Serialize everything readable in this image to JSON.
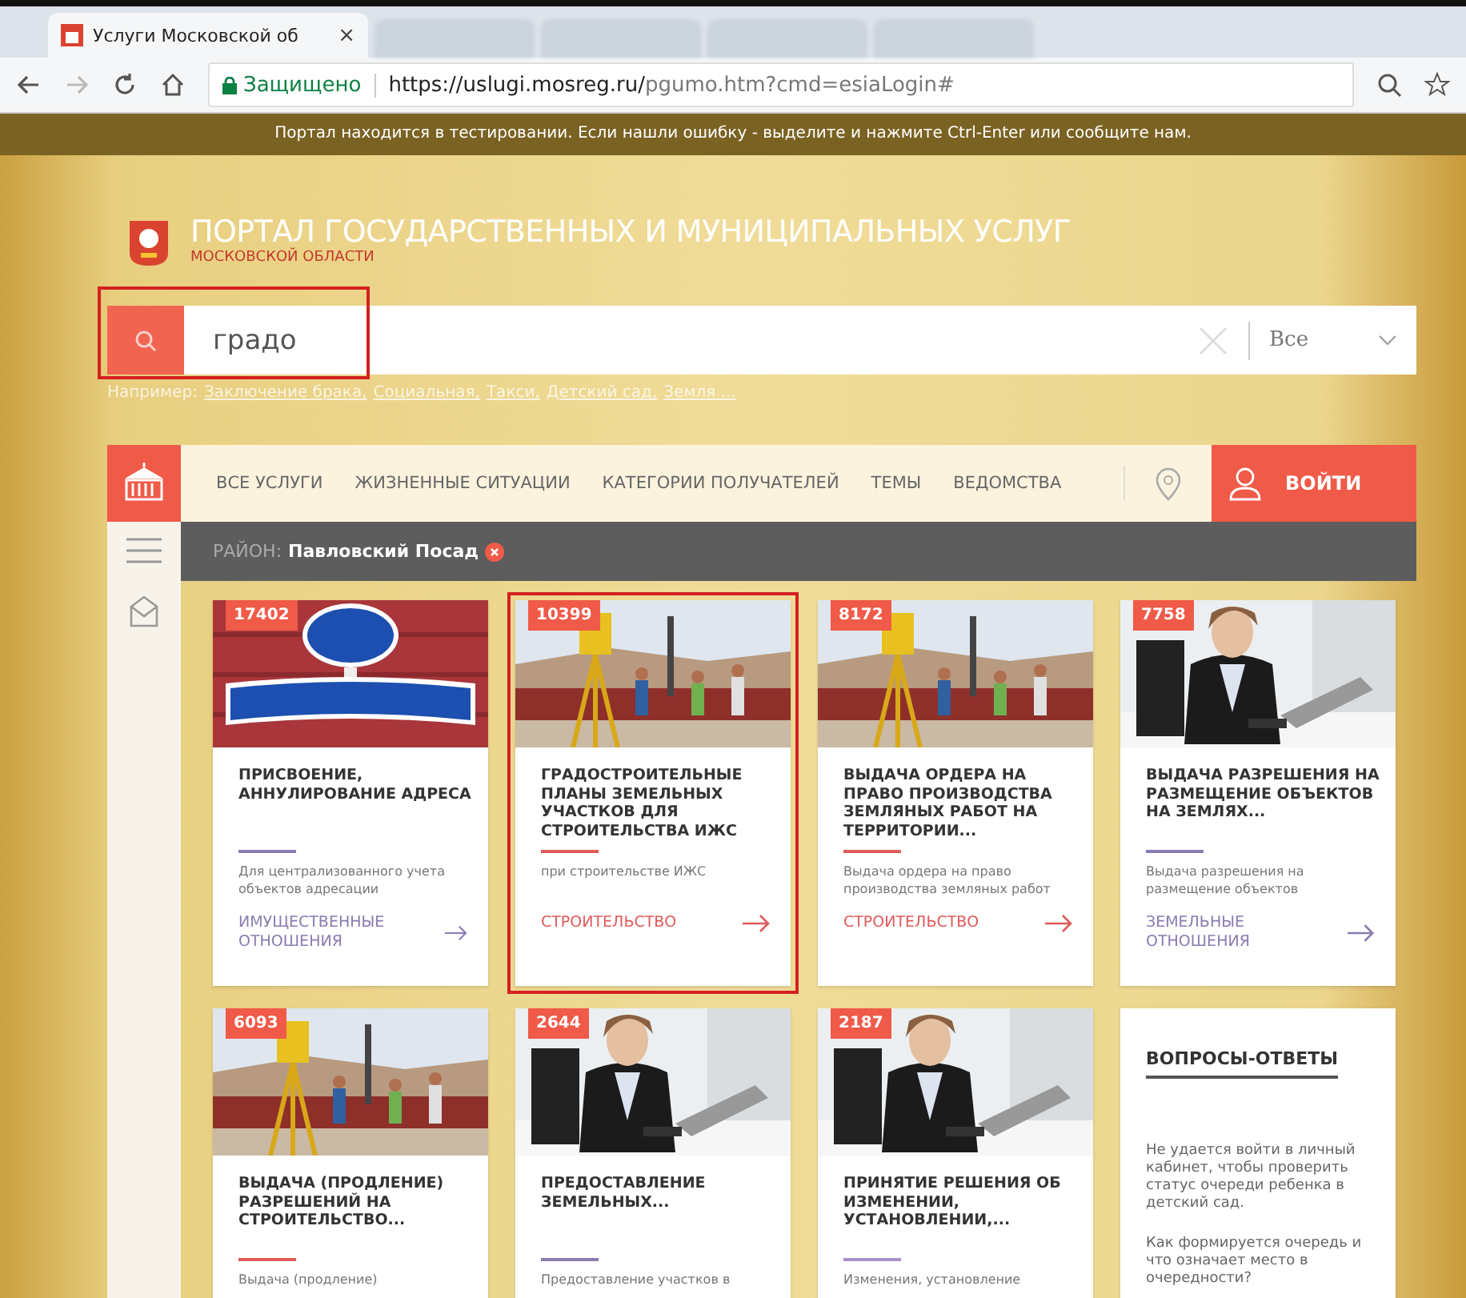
{
  "browser": {
    "tabs": [
      {
        "title": "Услуги Московской об",
        "selected": true
      },
      {
        "selected": false
      },
      {
        "selected": false
      },
      {
        "selected": false
      },
      {
        "selected": false
      }
    ],
    "tab_close": "×",
    "secure_label": "Защищено",
    "url_host": "https://uslugi.mosreg.ru/",
    "url_path": "pgumo.htm?cmd=esiaLogin#"
  },
  "notice": "Портал находится в тестировании. Если нашли ошибку - выделите и нажмите Ctrl-Enter или сообщите нам.",
  "header": {
    "title": "ПОРТАЛ ГОСУДАРСТВЕННЫХ И МУНИЦИПАЛЬНЫХ УСЛУГ",
    "subtitle": "МОСКОВСКОЙ ОБЛАСТИ"
  },
  "search": {
    "value": "градо",
    "highlighted": true,
    "scope": "Все",
    "hint_label": "Например:",
    "hints": [
      "Заключение брака,",
      "Социальная,",
      "Такси,",
      "Детский сад,",
      "Земля ..."
    ]
  },
  "nav": {
    "items": [
      "ВСЕ УСЛУГИ",
      "ЖИЗНЕННЫЕ СИТУАЦИИ",
      "КАТЕГОРИИ ПОЛУЧАТЕЛЕЙ",
      "ТЕМЫ",
      "ВЕДОМСТВА"
    ],
    "login": "ВОЙТИ"
  },
  "district": {
    "label": "РАЙОН:",
    "value": "Павловский Посад"
  },
  "cards": [
    {
      "kind": "picture",
      "count": "17402",
      "title": "ПРИСВОЕНИЕ, АННУЛИРОВАНИЕ АДРЕСА",
      "description": "Для централизованного учета объектов адресации",
      "category": "ИМУЩЕСТВЕННЫЕ ОТНОШЕНИЯ",
      "color": "#8a7bb0",
      "highlighted": false
    },
    {
      "kind": "picture",
      "count": "10399",
      "title": "ГРАДОСТРОИТЕЛЬНЫЕ ПЛАНЫ ЗЕМЕЛЬНЫХ УЧАСТКОВ ДЛЯ СТРОИТЕЛЬСТВА ИЖС",
      "description": "при строительстве ИЖС",
      "category": "СТРОИТЕЛЬСТВО",
      "color": "#e05a5a",
      "highlighted": true
    },
    {
      "kind": "picture",
      "count": "8172",
      "title": "ВЫДАЧА ОРДЕРА НА ПРАВО ПРОИЗВОДСТВА ЗЕМЛЯНЫХ РАБОТ НА ТЕРРИТОРИИ...",
      "description": "Выдача ордера на право производства земляных работ",
      "category": "СТРОИТЕЛЬСТВО",
      "color": "#e05a5a",
      "highlighted": false
    },
    {
      "kind": "picture",
      "count": "7758",
      "title": "ВЫДАЧА РАЗРЕШЕНИЯ НА РАЗМЕЩЕНИЕ ОБЪЕКТОВ НА ЗЕМЛЯХ...",
      "description": "Выдача разрешения на размещение объектов",
      "category": "ЗЕМЕЛЬНЫЕ ОТНОШЕНИЯ",
      "color": "#8a7bb0",
      "highlighted": false
    },
    {
      "kind": "picture",
      "count": "6093",
      "title": "ВЫДАЧА (ПРОДЛЕНИЕ) РАЗРЕШЕНИЙ НА СТРОИТЕЛЬСТВО...",
      "description": "Выдача (продление)",
      "color": "#e05a5a",
      "highlighted": false
    },
    {
      "kind": "picture",
      "count": "2644",
      "title": "ПРЕДОСТАВЛЕНИЕ ЗЕМЕЛЬНЫХ...",
      "description": "Предоставление участков в",
      "color": "#8a7bb0",
      "highlighted": false
    },
    {
      "kind": "picture",
      "count": "2187",
      "title": "ПРИНЯТИЕ РЕШЕНИЯ ОБ ИЗМЕНЕНИИ, УСТАНОВЛЕНИИ,...",
      "description": "Изменения, установление",
      "color": "#a890c8",
      "highlighted": false
    }
  ],
  "faq": {
    "title": "ВОПРОСЫ-ОТВЕТЫ",
    "questions": [
      "Не удается войти в личный кабинет, чтобы проверить статус очереди ребенка в детский сад.",
      "Как формируется очередь и что означает место в очередности?"
    ]
  }
}
